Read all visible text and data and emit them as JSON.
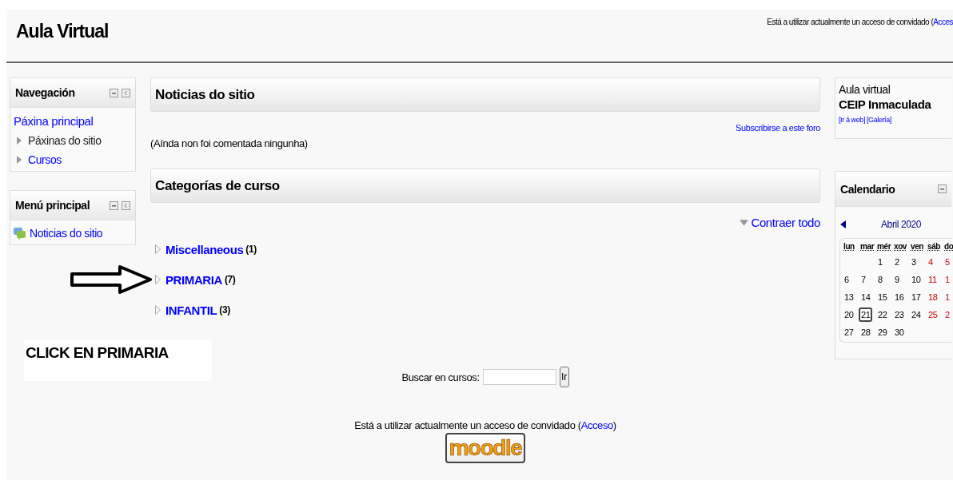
{
  "header": {
    "site_title": "Aula Virtual",
    "login_info": "Está a utilizar actualmente un acceso de convidado (",
    "login_link": "Acces"
  },
  "navigation": {
    "title": "Navegación",
    "root": "Páxina principal",
    "children": [
      {
        "label": "Páxinas do sitio",
        "link": false
      },
      {
        "label": "Cursos",
        "link": true
      }
    ]
  },
  "main_menu": {
    "title": "Menú principal",
    "items": [
      "Noticias do sitio"
    ]
  },
  "annotation": {
    "text": "CLICK EN PRIMARIA"
  },
  "news": {
    "title": "Noticias do sitio",
    "subscribe": "Subscribirse a este foro",
    "empty": "(Aínda non foi comentada ningunha)"
  },
  "categories": {
    "title": "Categorías de curso",
    "collapse_all": "Contraer todo",
    "items": [
      {
        "name": "Miscellaneous",
        "count": "(1)"
      },
      {
        "name": "PRIMARIA",
        "count": "(7)"
      },
      {
        "name": "INFANTIL",
        "count": "(3)"
      }
    ]
  },
  "search": {
    "label": "Buscar en cursos:",
    "button": "Ir"
  },
  "footer": {
    "login_info": "Está a utilizar actualmente un acceso de convidado (",
    "login_link": "Acceso",
    "close": ")",
    "logo": "moodle"
  },
  "info_block": {
    "line_1": "Aula virtual",
    "line_2": "CEIP Inmaculada",
    "links": [
      "[Ir á web]",
      "[Galería]"
    ]
  },
  "calendar": {
    "title": "Calendario",
    "month": "Abril 2020",
    "weekdays": [
      "lun",
      "mar",
      "mér",
      "xov",
      "ven",
      "sáb",
      "do"
    ],
    "weeks": [
      [
        {
          "day": "1",
          "today": false
        },
        {
          "day": "2",
          "today": false
        },
        {
          "day": "3",
          "today": false
        },
        {
          "day": "4",
          "today": false
        },
        {
          "day": "5",
          "today": false
        }
      ],
      [
        {
          "day": "6",
          "today": false
        },
        {
          "day": "7",
          "today": false
        },
        {
          "day": "8",
          "today": false
        },
        {
          "day": "9",
          "today": false
        },
        {
          "day": "10",
          "today": false
        },
        {
          "day": "11",
          "today": false
        },
        {
          "day": "1",
          "today": false
        }
      ],
      [
        {
          "day": "13",
          "today": false
        },
        {
          "day": "14",
          "today": false
        },
        {
          "day": "15",
          "today": false
        },
        {
          "day": "16",
          "today": false
        },
        {
          "day": "17",
          "today": false
        },
        {
          "day": "18",
          "today": false
        },
        {
          "day": "1",
          "today": false
        }
      ],
      [
        {
          "day": "20",
          "today": false
        },
        {
          "day": "21",
          "today": true
        },
        {
          "day": "22",
          "today": false
        },
        {
          "day": "23",
          "today": false
        },
        {
          "day": "24",
          "today": false
        },
        {
          "day": "25",
          "today": false
        },
        {
          "day": "2",
          "today": false
        }
      ],
      [
        {
          "day": "27",
          "today": false
        },
        {
          "day": "28",
          "today": false
        },
        {
          "day": "29",
          "today": false
        },
        {
          "day": "30",
          "today": false
        }
      ]
    ]
  }
}
